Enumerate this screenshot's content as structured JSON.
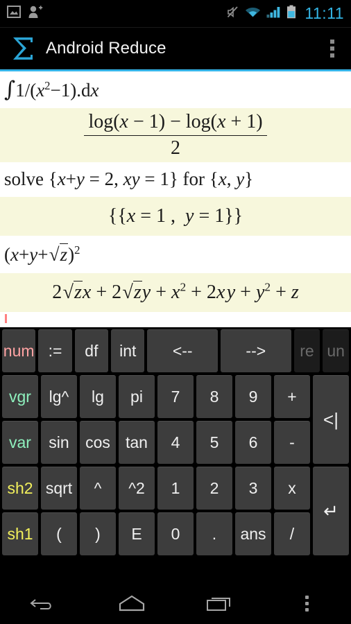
{
  "status_bar": {
    "left_icons": [
      "image-icon",
      "add-contact-icon"
    ],
    "right_icons": [
      "mute-icon",
      "wifi-icon",
      "signal-icon",
      "battery-icon"
    ],
    "clock": "11:11",
    "clock_color": "#33b5e5"
  },
  "action_bar": {
    "logo": "sigma-logo",
    "logo_color": "#33b5e5",
    "title": "Android Reduce",
    "overflow": "overflow-menu-icon",
    "accent_color": "#35b3e7"
  },
  "expressions": [
    {
      "input_text": "∫1/(x²−1).dx",
      "answer_text": "(log(x − 1) − log(x + 1)) / 2"
    },
    {
      "input_text": "solve {x+y = 2, xy = 1} for {x, y}",
      "answer_text": "{{x = 1 , y = 1}}"
    },
    {
      "input_text": "(x+y+√z)²",
      "answer_text": "2√z x + 2√z y + x² + 2xy + y² + z"
    }
  ],
  "caret": {
    "color": "#ff8080"
  },
  "keyboard": {
    "rows": [
      [
        {
          "label": "num",
          "style": "pink",
          "span": 1
        },
        {
          "label": ":=",
          "style": "normal",
          "span": 1
        },
        {
          "label": "df",
          "style": "normal",
          "span": 1
        },
        {
          "label": "int",
          "style": "normal",
          "span": 1
        },
        {
          "label": "<--",
          "style": "normal",
          "span": 2
        },
        {
          "label": "-->",
          "style": "normal",
          "span": 2
        },
        {
          "label": "re",
          "style": "disabled",
          "span": 1
        },
        {
          "label": "un",
          "style": "disabled",
          "span": 1
        }
      ],
      [
        {
          "label": "vgr",
          "style": "green",
          "span": 1
        },
        {
          "label": "lg^",
          "style": "normal",
          "span": 1
        },
        {
          "label": "lg",
          "style": "normal",
          "span": 1
        },
        {
          "label": "pi",
          "style": "normal",
          "span": 1
        },
        {
          "label": "7",
          "style": "normal",
          "span": 1
        },
        {
          "label": "8",
          "style": "normal",
          "span": 1
        },
        {
          "label": "9",
          "style": "normal",
          "span": 1
        },
        {
          "label": "+",
          "style": "normal",
          "span": 1
        }
      ],
      [
        {
          "label": "var",
          "style": "green",
          "span": 1
        },
        {
          "label": "sin",
          "style": "normal",
          "span": 1
        },
        {
          "label": "cos",
          "style": "normal",
          "span": 1
        },
        {
          "label": "tan",
          "style": "normal",
          "span": 1
        },
        {
          "label": "4",
          "style": "normal",
          "span": 1
        },
        {
          "label": "5",
          "style": "normal",
          "span": 1
        },
        {
          "label": "6",
          "style": "normal",
          "span": 1
        },
        {
          "label": "-",
          "style": "normal",
          "span": 1
        }
      ],
      [
        {
          "label": "sh2",
          "style": "yellow",
          "span": 1
        },
        {
          "label": "sqrt",
          "style": "normal",
          "span": 1
        },
        {
          "label": "^",
          "style": "normal",
          "span": 1
        },
        {
          "label": "^2",
          "style": "normal",
          "span": 1
        },
        {
          "label": "1",
          "style": "normal",
          "span": 1
        },
        {
          "label": "2",
          "style": "normal",
          "span": 1
        },
        {
          "label": "3",
          "style": "normal",
          "span": 1
        },
        {
          "label": "x",
          "style": "normal",
          "span": 1
        }
      ],
      [
        {
          "label": "sh1",
          "style": "yellow",
          "span": 1
        },
        {
          "label": "(",
          "style": "normal",
          "span": 1
        },
        {
          "label": ")",
          "style": "normal",
          "span": 1
        },
        {
          "label": "E",
          "style": "normal",
          "span": 1
        },
        {
          "label": "0",
          "style": "normal",
          "span": 1
        },
        {
          "label": ".",
          "style": "normal",
          "span": 1
        },
        {
          "label": "ans",
          "style": "normal",
          "span": 1
        },
        {
          "label": "/",
          "style": "normal",
          "span": 1
        }
      ]
    ],
    "side_keys": {
      "backspace": "<|",
      "enter": "↵"
    },
    "colors": {
      "key_bg": "#3d3d3d",
      "key_text": "#f0f0f0",
      "pink": "#ffa3a3",
      "green": "#8ef0bd",
      "yellow": "#f2f05c",
      "disabled_bg": "#1c1c1c",
      "disabled_text": "#6a6a6a"
    }
  },
  "nav_bar": {
    "buttons": [
      "back-icon",
      "home-icon",
      "recents-icon",
      "nav-overflow-icon"
    ]
  }
}
